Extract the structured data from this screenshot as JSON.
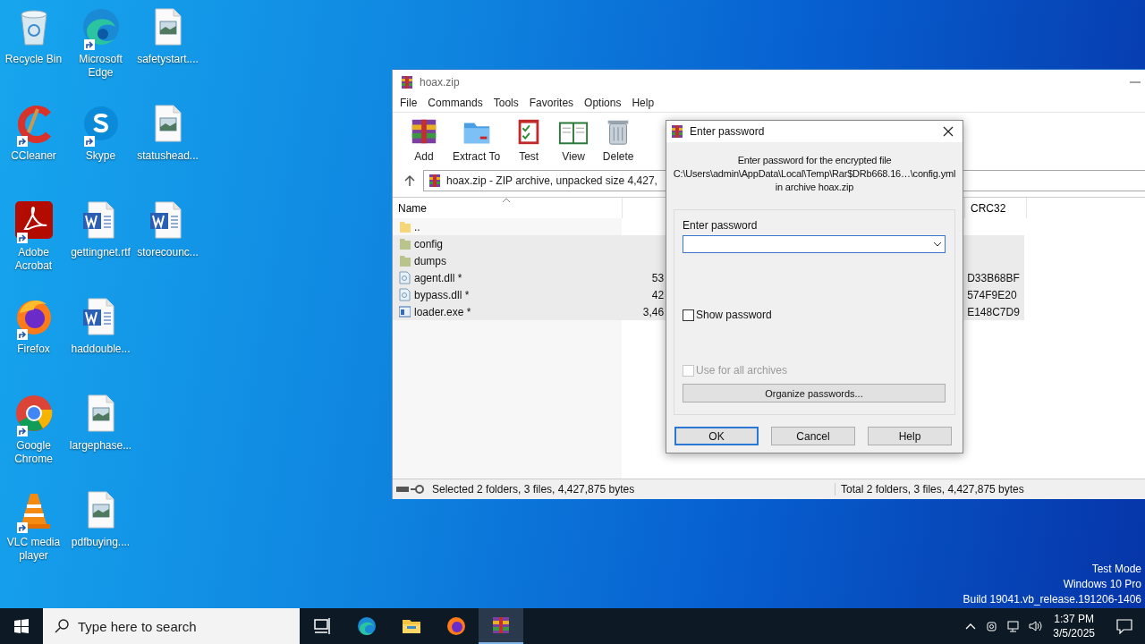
{
  "desktop": {
    "icons": [
      {
        "label": "Recycle Bin",
        "kind": "recycle",
        "shortcut": false
      },
      {
        "label": "CCleaner",
        "kind": "ccleaner",
        "shortcut": true
      },
      {
        "label": "Adobe Acrobat",
        "kind": "acrobat",
        "shortcut": true
      },
      {
        "label": "Firefox",
        "kind": "firefox",
        "shortcut": true
      },
      {
        "label": "Google Chrome",
        "kind": "chrome",
        "shortcut": true
      },
      {
        "label": "VLC media player",
        "kind": "vlc",
        "shortcut": true
      },
      {
        "label": "Microsoft Edge",
        "kind": "edge",
        "shortcut": true
      },
      {
        "label": "Skype",
        "kind": "skype",
        "shortcut": true
      },
      {
        "label": "gettingnet.rtf",
        "kind": "word",
        "shortcut": false
      },
      {
        "label": "haddouble...",
        "kind": "word",
        "shortcut": false
      },
      {
        "label": "largephase...",
        "kind": "image",
        "shortcut": false
      },
      {
        "label": "pdfbuying....",
        "kind": "image",
        "shortcut": false
      },
      {
        "label": "safetystart....",
        "kind": "image",
        "shortcut": false
      },
      {
        "label": "statushead...",
        "kind": "image",
        "shortcut": false
      },
      {
        "label": "storecounc...",
        "kind": "word",
        "shortcut": false
      }
    ],
    "system_text": [
      "Test Mode",
      "Windows 10 Pro",
      "Build 19041.vb_release.191206-1406"
    ]
  },
  "archive_window": {
    "title": "hoax.zip",
    "menu": [
      "File",
      "Commands",
      "Tools",
      "Favorites",
      "Options",
      "Help"
    ],
    "toolbar": [
      {
        "label": "Add",
        "kind": "add"
      },
      {
        "label": "Extract To",
        "kind": "extract"
      },
      {
        "label": "Test",
        "kind": "test"
      },
      {
        "label": "View",
        "kind": "view"
      },
      {
        "label": "Delete",
        "kind": "delete"
      }
    ],
    "address": "hoax.zip - ZIP archive, unpacked size 4,427,",
    "columns": {
      "name": "Name",
      "crc": "CRC32"
    },
    "rows": [
      {
        "name": "..",
        "kind": "up",
        "selected": false
      },
      {
        "name": "config",
        "kind": "folder",
        "selected": true
      },
      {
        "name": "dumps",
        "kind": "folder",
        "selected": true
      },
      {
        "name": "agent.dll *",
        "kind": "dll",
        "size": "53",
        "crc": "D33B68BF",
        "selected": true
      },
      {
        "name": "bypass.dll *",
        "kind": "dll",
        "size": "42",
        "crc": "574F9E20",
        "selected": true
      },
      {
        "name": "loader.exe *",
        "kind": "exe",
        "size": "3,46",
        "crc": "E148C7D9",
        "selected": true
      }
    ],
    "status_bar": {
      "selected": "Selected 2 folders, 3 files, 4,427,875 bytes",
      "total": "Total 2 folders, 3 files, 4,427,875 bytes"
    }
  },
  "password_dialog": {
    "title": "Enter password",
    "message": [
      "Enter password for the encrypted file",
      "C:\\Users\\admin\\AppData\\Local\\Temp\\Rar$DRb668.16…\\config.yml",
      "in archive hoax.zip"
    ],
    "field_label": "Enter password",
    "show_password": {
      "label": "Show password",
      "checked": false,
      "disabled": false
    },
    "use_for_all": {
      "label": "Use for all archives",
      "checked": false,
      "disabled": true
    },
    "organize_button": "Organize passwords...",
    "buttons": [
      {
        "label": "OK",
        "default": true
      },
      {
        "label": "Cancel",
        "default": false
      },
      {
        "label": "Help",
        "default": false
      }
    ]
  },
  "taskbar": {
    "search_placeholder": "Type here to search",
    "apps": [
      {
        "kind": "taskview",
        "active": false
      },
      {
        "kind": "edge",
        "active": false
      },
      {
        "kind": "explorer",
        "active": false
      },
      {
        "kind": "firefox",
        "active": false
      },
      {
        "kind": "winrar",
        "active": true
      }
    ],
    "time": "1:37 PM",
    "date": "3/5/2025"
  }
}
